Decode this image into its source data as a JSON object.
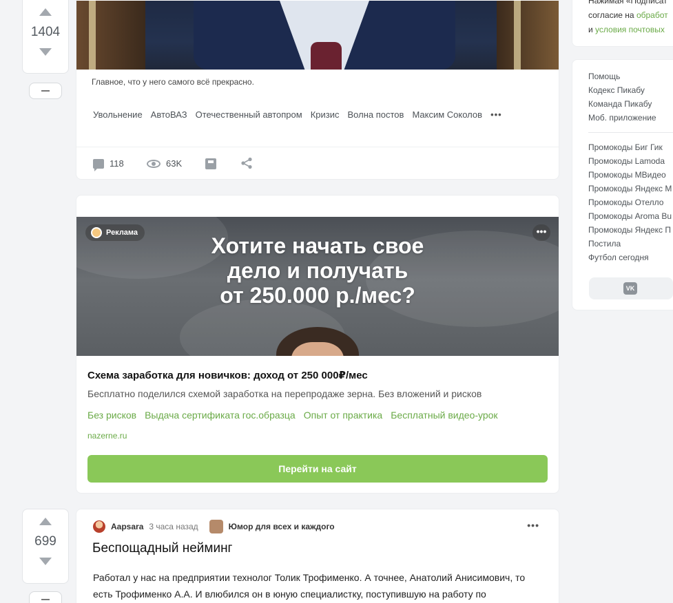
{
  "post1": {
    "rating": "1404",
    "caption": "Главное, что у него самого всё прекрасно.",
    "tags": [
      "Увольнение",
      "АвтоВАЗ",
      "Отечественный автопром",
      "Кризис",
      "Волна постов",
      "Максим Соколов"
    ],
    "tags_more": "•••",
    "comments": "118",
    "views": "63K"
  },
  "ad": {
    "badge": "Реклама",
    "more": "•••",
    "headline_lines": [
      "Хотите начать свое",
      "дело и получать",
      "от 250.000 р./мес?"
    ],
    "title": "Схема заработка для новичков: доход от 250 000₽/мес",
    "description": "Бесплатно поделился схемой заработка на перепродаже зерна. Без вложений и рисков",
    "links": [
      "Без рисков",
      "Выдача сертификата гос.образца",
      "Опыт от практика",
      "Бесплатный видео-урок"
    ],
    "domain": "nazerne.ru",
    "cta": "Перейти на сайт"
  },
  "post2": {
    "rating": "699",
    "author": "Aapsara",
    "time": "3 часа назад",
    "community": "Юмор для всех и каждого",
    "more": "•••",
    "title": "Беспощадный нейминг",
    "body_lines": [
      "Работал у нас на предприятии технолог Толик Трофименко. А точнее, Анатолий Анисимович, то",
      "есть Трофименко А.А. И влюбился он в юную специалистку, поступившую на работу по"
    ]
  },
  "sidebar": {
    "subscribe_lines": [
      "Нажимая «Подписат",
      "согласие на ",
      "обработ",
      "и ",
      "условия почтовых"
    ],
    "links_main": [
      "Помощь",
      "Кодекс Пикабу",
      "Команда Пикабу",
      "Моб. приложение"
    ],
    "links_promo": [
      "Промокоды Биг Гик",
      "Промокоды Lamoda",
      "Промокоды МВидео",
      "Промокоды Яндекс М",
      "Промокоды Отелло",
      "Промокоды Aroma Bu",
      "Промокоды Яндекс П",
      "Постила",
      "Футбол сегодня"
    ],
    "vk_label": "VK"
  }
}
